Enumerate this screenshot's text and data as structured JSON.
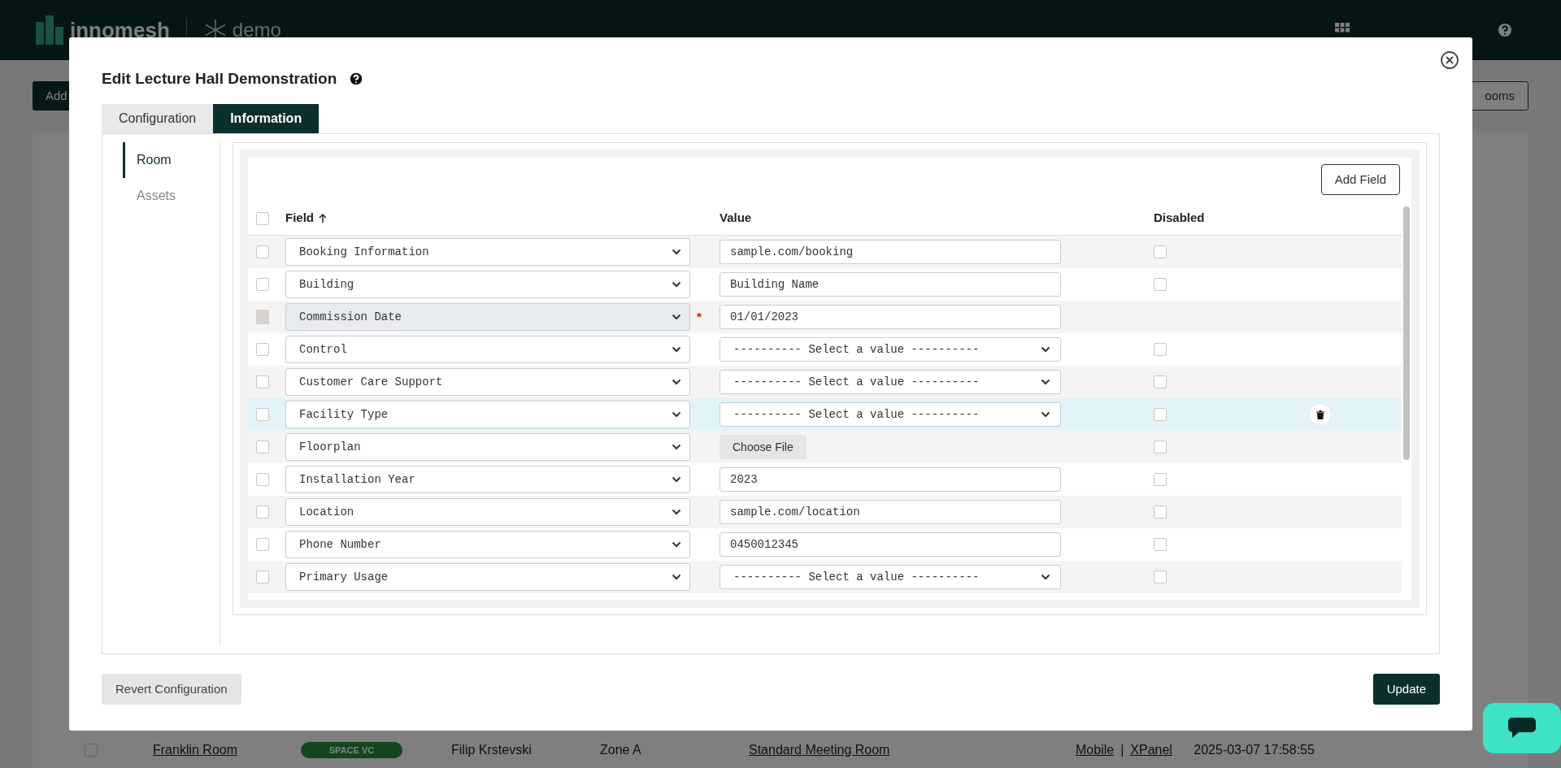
{
  "app": {
    "logo": "innomesh",
    "tenant": "demo",
    "toolbar_left": "Add",
    "toolbar_right": "ooms",
    "background_row": {
      "checked": false,
      "name": "Franklin Room",
      "tag": "SPACE VC",
      "owner": "Filip Krstevski",
      "zone": "Zone A",
      "template": "Standard Meeting Room",
      "links": [
        "Mobile",
        "XPanel"
      ],
      "separator": "|",
      "timestamp": "2025-03-07 17:58:55"
    }
  },
  "modal": {
    "title": "Edit Lecture Hall Demonstration",
    "tabs": [
      {
        "label": "Configuration",
        "selected": false
      },
      {
        "label": "Information",
        "selected": true
      }
    ],
    "side_nav": [
      {
        "label": "Room",
        "selected": true
      },
      {
        "label": "Assets",
        "selected": false
      }
    ],
    "add_field": "Add Field",
    "required_mark": "*",
    "select_all_checked": false,
    "columns": [
      "Field",
      "Value",
      "Disabled"
    ],
    "rows": [
      {
        "field": "Booking Information",
        "kind": "text",
        "value": "sample.com/booking",
        "checked": false,
        "locked": false,
        "required": false,
        "disabled": false,
        "highlighted": false
      },
      {
        "field": "Building",
        "kind": "text",
        "value": "Building Name",
        "checked": false,
        "locked": false,
        "required": false,
        "disabled": false,
        "highlighted": false
      },
      {
        "field": "Commission Date",
        "kind": "text",
        "value": "01/01/2023",
        "checked": false,
        "locked": true,
        "required": true,
        "highlighted": false
      },
      {
        "field": "Control",
        "kind": "select",
        "value": "---------- Select a value ----------",
        "checked": false,
        "locked": false,
        "required": false,
        "disabled": false,
        "highlighted": false
      },
      {
        "field": "Customer Care Support",
        "kind": "select",
        "value": "---------- Select a value ----------",
        "checked": false,
        "locked": false,
        "required": false,
        "disabled": false,
        "highlighted": false
      },
      {
        "field": "Facility Type",
        "kind": "select",
        "value": "---------- Select a value ----------",
        "checked": false,
        "locked": false,
        "required": false,
        "disabled": false,
        "highlighted": true
      },
      {
        "field": "Floorplan",
        "kind": "file",
        "value": "Choose File",
        "checked": false,
        "locked": false,
        "required": false,
        "disabled": false,
        "highlighted": false
      },
      {
        "field": "Installation Year",
        "kind": "text",
        "value": "2023",
        "checked": false,
        "locked": false,
        "required": false,
        "disabled": false,
        "highlighted": false
      },
      {
        "field": "Location",
        "kind": "text",
        "value": "sample.com/location",
        "checked": false,
        "locked": false,
        "required": false,
        "disabled": false,
        "highlighted": false
      },
      {
        "field": "Phone Number",
        "kind": "text",
        "value": "0450012345",
        "checked": false,
        "locked": false,
        "required": false,
        "disabled": false,
        "highlighted": false
      },
      {
        "field": "Primary Usage",
        "kind": "select",
        "value": "---------- Select a value ----------",
        "checked": false,
        "locked": false,
        "required": false,
        "disabled": false,
        "highlighted": false
      }
    ],
    "buttons": {
      "revert": "Revert Configuration",
      "update": "Update"
    }
  }
}
